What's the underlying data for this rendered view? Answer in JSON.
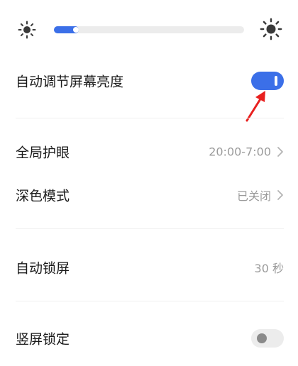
{
  "brightness": {
    "level_percent": 13,
    "low_icon": "sun-small-icon",
    "high_icon": "sun-large-icon"
  },
  "settings": {
    "auto_brightness": {
      "label": "自动调节屏幕亮度",
      "enabled": true
    },
    "eye_protection": {
      "label": "全局护眼",
      "value": "20:00-7:00"
    },
    "dark_mode": {
      "label": "深色模式",
      "value": "已关闭"
    },
    "auto_lock": {
      "label": "自动锁屏",
      "value": "30 秒"
    },
    "portrait_lock": {
      "label": "竖屏锁定",
      "enabled": false
    }
  },
  "colors": {
    "accent": "#3b6fe8",
    "annotation": "#e8201f",
    "secondary_text": "#9a9a9a"
  }
}
